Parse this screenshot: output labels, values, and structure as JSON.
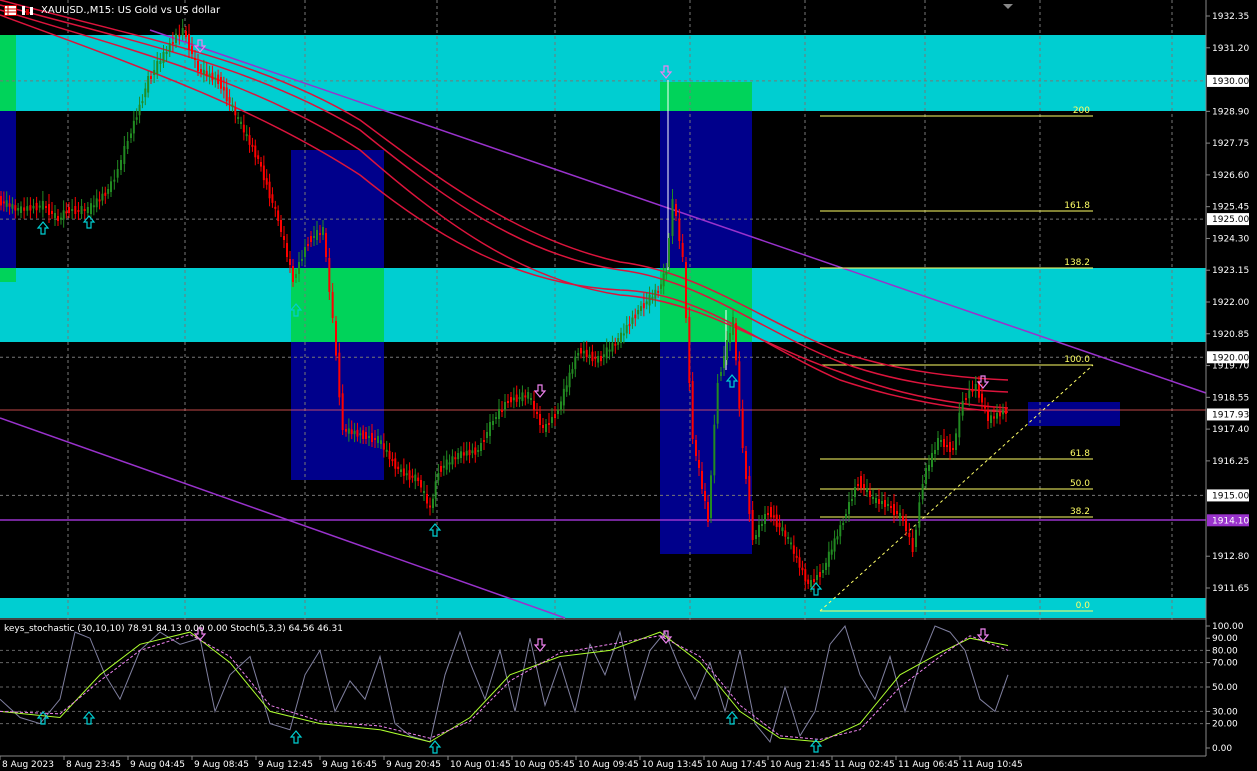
{
  "window": {
    "title": "XAUUSD.,M15: US Gold vs US dollar"
  },
  "indicator": {
    "title": "keys_stochastic (30,10,10) 78.91 84.13 0.00 0.00 Stoch(5,3,3) 64.56 46.31"
  },
  "price_axis": {
    "labels": [
      "1932.35",
      "1931.20",
      "1930.00",
      "1928.90",
      "1927.75",
      "1926.60",
      "1925.45",
      "1925.00",
      "1924.30",
      "1923.15",
      "1922.00",
      "1920.85",
      "1920.00",
      "1919.70",
      "1918.55",
      "1917.93",
      "1917.40",
      "1916.25",
      "1915.00",
      "1914.10",
      "1912.80",
      "1911.65"
    ],
    "highlighted": {
      "1930.00": "#ffffff",
      "1925.00": "#ffffff",
      "1920.00": "#ffffff",
      "1915.00": "#ffffff",
      "1917.93": "#ffffff",
      "1914.10": "#9932cc"
    }
  },
  "indicator_axis": {
    "labels": [
      "100.00",
      "90.00",
      "80.00",
      "70.00",
      "50.00",
      "30.00",
      "20.00",
      "0.00"
    ]
  },
  "time_axis": {
    "labels": [
      "8 Aug 2023",
      "8 Aug 23:45",
      "9 Aug 04:45",
      "9 Aug 08:45",
      "9 Aug 12:45",
      "9 Aug 16:45",
      "9 Aug 20:45",
      "10 Aug 01:45",
      "10 Aug 05:45",
      "10 Aug 09:45",
      "10 Aug 13:45",
      "10 Aug 17:45",
      "10 Aug 21:45",
      "11 Aug 02:45",
      "11 Aug 06:45",
      "11 Aug 10:45"
    ]
  },
  "fibonacci": {
    "levels": [
      "200",
      "161.8",
      "138.2",
      "100.0",
      "61.8",
      "50.0",
      "38.2",
      "0.0"
    ]
  },
  "colors": {
    "background": "#000000",
    "bull": "#228b22",
    "bear": "#ff0000",
    "supply_zone": "#00ced1",
    "order_block_blue": "#00008b",
    "order_block_green": "#00d35a",
    "moving_average": "#dc143c",
    "trendline": "#9932cc",
    "fib": "#ffff66",
    "arrow_up": "#00ced1",
    "arrow_down": "#ee82ee"
  }
}
